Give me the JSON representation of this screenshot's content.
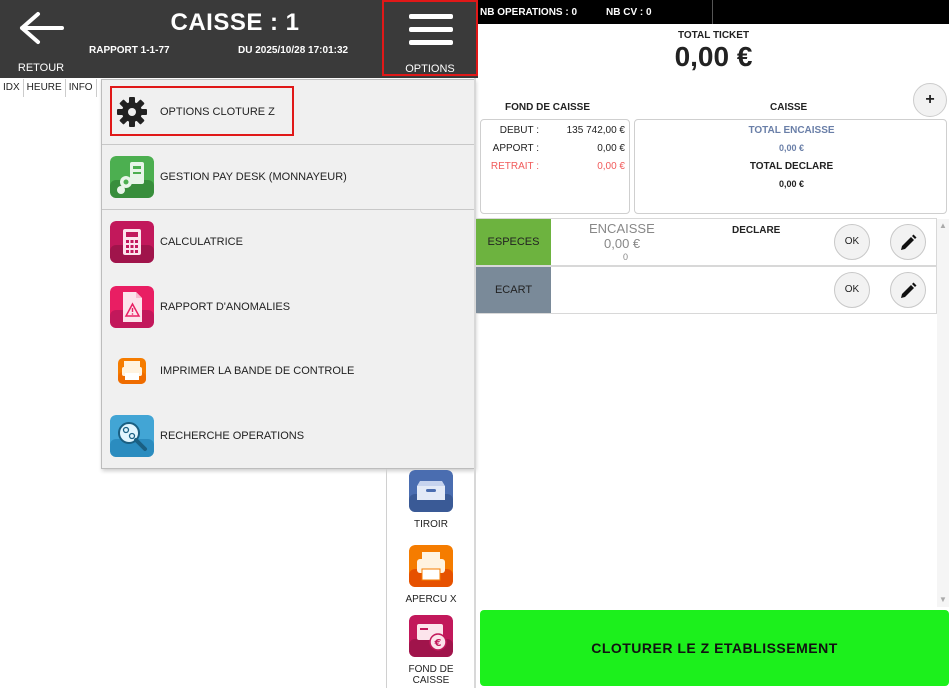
{
  "header": {
    "back_label": "RETOUR",
    "title": "CAISSE : 1",
    "rapport": "RAPPORT 1-1-77",
    "date": "DU 2025/10/28 17:01:32",
    "options_label": "OPTIONS"
  },
  "stats": {
    "nb_operations": "NB OPERATIONS : 0",
    "nb_cv": "NB CV : 0"
  },
  "total_ticket": {
    "label": "TOTAL TICKET",
    "value": "0,00 €"
  },
  "table": {
    "columns": [
      "IDX",
      "HEURE",
      "INFO"
    ]
  },
  "menu": {
    "items": [
      {
        "label": "OPTIONS CLOTURE Z",
        "icon": "gear-icon"
      },
      {
        "label": "GESTION PAY DESK (MONNAYEUR)",
        "icon": "pay-desk-icon",
        "color": "#4caf50"
      },
      {
        "label": "CALCULATRICE",
        "icon": "calculator-icon",
        "color": "#c2185b"
      },
      {
        "label": "RAPPORT D'ANOMALIES",
        "icon": "anomaly-report-icon",
        "color": "#e91e63"
      },
      {
        "label": "IMPRIMER LA BANDE DE CONTROLE",
        "icon": "printer-icon",
        "color": "#f57c00"
      },
      {
        "label": "RECHERCHE OPERATIONS",
        "icon": "search-operations-icon",
        "color": "#42a5d5"
      }
    ]
  },
  "side_buttons": {
    "tiroir": {
      "label": "TIROIR",
      "icon": "drawer-icon",
      "color": "#4a6db0"
    },
    "apercu": {
      "label": "APERCU X",
      "icon": "printer-icon",
      "color": "#f57c00"
    },
    "fond": {
      "label": "FOND DE CAISSE",
      "icon": "cash-fund-icon",
      "color": "#c2185b"
    }
  },
  "fond_de_caisse": {
    "label": "FOND DE CAISSE",
    "debut_label": "DEBUT :",
    "debut_value": "135 742,00 €",
    "apport_label": "APPORT :",
    "apport_value": "0,00 €",
    "retrait_label": "RETRAIT :",
    "retrait_value": "0,00 €"
  },
  "caisse": {
    "label": "CAISSE",
    "total_encaisse_label": "TOTAL ENCAISSE",
    "total_encaisse_value": "0,00 €",
    "total_declare_label": "TOTAL DECLARE",
    "total_declare_value": "0,00 €"
  },
  "payments": [
    {
      "tag": "ESPECES",
      "color": "#6db33f",
      "encaisse_label": "ENCAISSE",
      "encaisse_value": "0,00 €",
      "count": "0",
      "declare_label": "DECLARE",
      "ok": "OK"
    },
    {
      "tag": "ECART",
      "color": "#7a8a99",
      "ok": "OK"
    }
  ],
  "plus_label": "+",
  "cloturer_label": "CLOTURER LE Z ETABLISSEMENT",
  "colors": {
    "highlight": "#e01818",
    "cloturer": "#1cf01c",
    "retrait": "#f15a5a",
    "encaisse": "#6a7fa8"
  }
}
